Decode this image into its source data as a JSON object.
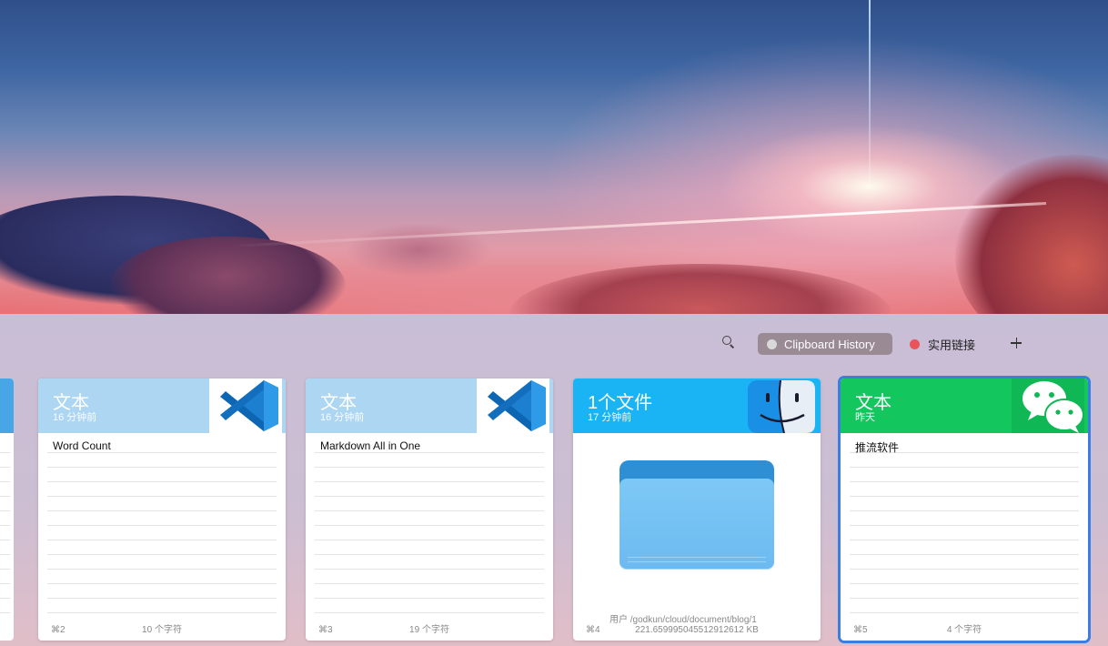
{
  "toolbar": {
    "tabs": [
      {
        "label": "Clipboard History",
        "dot_color": "#d8d8d8",
        "active": true
      },
      {
        "label": "实用链接",
        "dot_color": "#e9545a",
        "active": false
      }
    ]
  },
  "cards": [
    {
      "type": "文本",
      "time": "16 分钟前",
      "content": "Word Count",
      "shortcut": "⌘2",
      "info": "10 个字符",
      "header_color": "#add6f3",
      "app_icon": "vscode-icon"
    },
    {
      "type": "文本",
      "time": "16 分钟前",
      "content": "Markdown All in One",
      "shortcut": "⌘3",
      "info": "19 个字符",
      "header_color": "#add6f3",
      "app_icon": "vscode-icon"
    },
    {
      "type": "1个文件",
      "time": "17 分钟前",
      "path": "用户 /godkun/cloud/document/blog/1",
      "shortcut": "⌘4",
      "info": "221.659995045512912612 KB",
      "header_color": "#1ab4f5",
      "app_icon": "finder-icon",
      "content_icon": "folder-icon"
    },
    {
      "type": "文本",
      "time": "昨天",
      "content": "推流软件",
      "shortcut": "⌘5",
      "info": "4 个字符",
      "header_color": "#13c75e",
      "app_icon": "wechat-icon",
      "selected": true
    }
  ],
  "colors": {
    "selection": "#3b7de0"
  }
}
